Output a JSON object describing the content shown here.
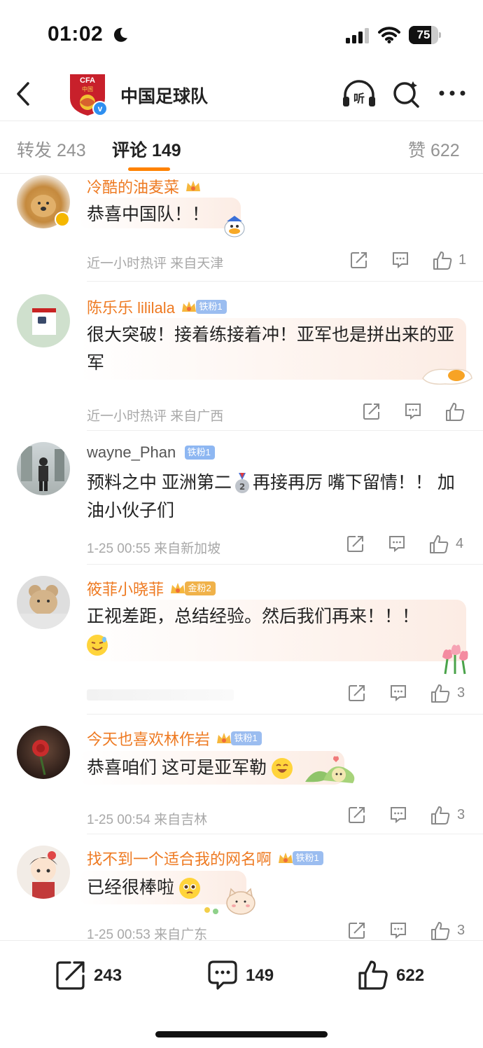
{
  "status": {
    "time": "01:02",
    "battery": "75",
    "battery_level": 0.75
  },
  "header": {
    "logo_text": "中国",
    "title": "中国足球队"
  },
  "tabs": [
    {
      "label": "转发",
      "count": "243"
    },
    {
      "label": "评论",
      "count": "149"
    },
    {
      "label": "赞",
      "count": "622"
    }
  ],
  "comments": [
    {
      "name": "冷酷的油麦菜",
      "fan_badge": "",
      "text": "恭喜中国队！！",
      "meta": "近一小时热评  来自天津",
      "likes": "1"
    },
    {
      "name": "陈乐乐 lililala",
      "fan_badge": "铁粉1",
      "text": "很大突破！接着练接着冲！亚军也是拼出来的亚军",
      "meta": "近一小时热评  来自广西",
      "likes": ""
    },
    {
      "name": "wayne_Phan",
      "fan_badge": "铁粉1",
      "text_a": "预料之中 亚洲第二",
      "text_b": "再接再厉 嘴下留情！！ 加油小伙子们",
      "meta": "1-25 00:55  来自新加坡",
      "likes": "4"
    },
    {
      "name": "筱菲小晓菲",
      "fan_badge": "金粉2",
      "text": "正视差距，总结经验。然后我们再来！！！",
      "meta": "",
      "likes": "3"
    },
    {
      "name": "今天也喜欢林作岩",
      "fan_badge": "铁粉1",
      "text": "恭喜咱们 这可是亚军勒",
      "meta": "1-25 00:54  来自吉林",
      "likes": "3"
    },
    {
      "name": "找不到一个适合我的网名啊",
      "fan_badge": "铁粉1",
      "text": "已经很棒啦",
      "meta": "1-25 00:53  来自广东",
      "likes": "3"
    }
  ],
  "bottom_bar": {
    "repost_count": "243",
    "comment_count": "149",
    "like_count": "622"
  },
  "colors": {
    "accent": "#ff8200",
    "username": "#ee7a22",
    "meta": "#a8a8a8"
  }
}
